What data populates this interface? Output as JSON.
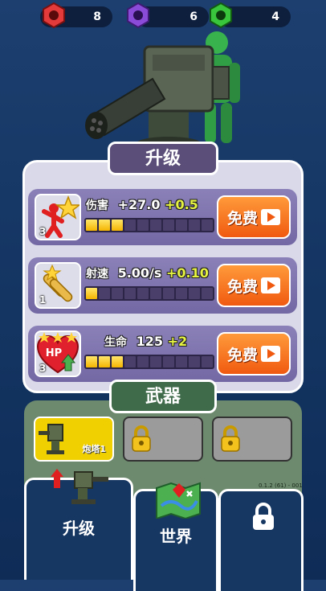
{
  "resources": [
    {
      "name": "red-nut",
      "color": "#e33b3b",
      "count": "8"
    },
    {
      "name": "purple-nut",
      "color": "#8a4cd8",
      "count": "6"
    },
    {
      "name": "green-nut",
      "color": "#39c53c",
      "count": "4"
    }
  ],
  "upgrade": {
    "title": "升级",
    "rows": [
      {
        "name": "伤害",
        "value": "+27.0",
        "bonus": "+0.5",
        "level": "3",
        "filled": 3,
        "total": 10,
        "button": "免费"
      },
      {
        "name": "射速",
        "value": "5.00/s",
        "bonus": "+0.10",
        "level": "1",
        "filled": 1,
        "total": 10,
        "button": "免费"
      },
      {
        "name": "生命",
        "value": "125",
        "bonus": "+2",
        "level": "3",
        "filled": 3,
        "total": 10,
        "button": "免费"
      }
    ],
    "hp_label": "HP"
  },
  "weapons": {
    "title": "武器",
    "slots": [
      {
        "label": "炮塔1"
      },
      {
        "label": ""
      },
      {
        "label": ""
      }
    ],
    "version": "0.1.2 (61) - 001"
  },
  "nav": {
    "tabs": [
      {
        "label": "升级"
      },
      {
        "label": "世界"
      },
      {
        "label": ""
      }
    ]
  }
}
